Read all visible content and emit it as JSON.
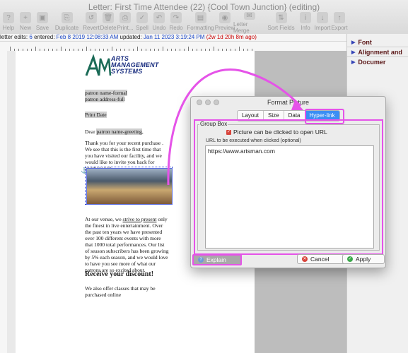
{
  "window": {
    "title": "Letter: First Time Attendee (22) {Cool Town Junction} (editing)"
  },
  "toolbar": [
    {
      "label": "Help",
      "icon": "help-icon",
      "glyph": "?"
    },
    {
      "label": "New",
      "icon": "new-icon",
      "glyph": "+"
    },
    {
      "label": "Save",
      "icon": "save-icon",
      "glyph": "▣"
    },
    {
      "label": "Duplicate",
      "icon": "duplicate-icon",
      "glyph": "⎘"
    },
    {
      "label": "Revert",
      "icon": "revert-icon",
      "glyph": "↺"
    },
    {
      "label": "Delete",
      "icon": "delete-icon",
      "glyph": "🗑"
    },
    {
      "label": "Print...",
      "icon": "print-icon",
      "glyph": "⎙"
    },
    {
      "label": "Spell",
      "icon": "spell-icon",
      "glyph": "✓"
    },
    {
      "label": "Undo",
      "icon": "undo-icon",
      "glyph": "↶"
    },
    {
      "label": "Redo",
      "icon": "redo-icon",
      "glyph": "↷"
    },
    {
      "label": "Formatting",
      "icon": "formatting-icon",
      "glyph": "▤"
    },
    {
      "label": "Preview",
      "icon": "preview-icon",
      "glyph": "◉"
    },
    {
      "label": "Letter Merge",
      "icon": "letter-merge-icon",
      "glyph": "✉"
    },
    {
      "label": "Sort Fields",
      "icon": "sort-fields-icon",
      "glyph": "⇅"
    },
    {
      "label": "Info",
      "icon": "info-icon",
      "glyph": "i"
    },
    {
      "label": "Import",
      "icon": "import-icon",
      "glyph": "↓"
    },
    {
      "label": "Export",
      "icon": "export-icon",
      "glyph": "↑"
    }
  ],
  "editsbar": {
    "edits_label": "letter edits:",
    "edits_count": "6",
    "entered_label": "entered:",
    "entered_value": "Feb 8 2019 12:08:33 AM",
    "updated_label": "updated:",
    "updated_value": "Jan 11 2023 3:19:24 PM",
    "elapsed": "(2w 1d 20h 8m ago)"
  },
  "right_panel": {
    "items": [
      "Font",
      "Alignment and",
      "Documer"
    ]
  },
  "document": {
    "logo_lines": [
      "ARTS",
      "MANAGEMENT",
      "SYSTEMS"
    ],
    "name_formal": "patron name-formal",
    "address_full": "patron address-full",
    "print_date": "Print Date",
    "greeting_prefix": "Dear ",
    "greeting_field": "patron name-greeting",
    "greeting_suffix": ",",
    "paragraph1": "Thank you for your recent purchase . We see that this is the first time that you have visited our facility, and we would like to invite you back for another visit.",
    "paragraph2_a": "At our venue, we ",
    "paragraph2_u": "strive to present",
    "paragraph2_b": " only the finest in live entertainment. Over the past ten years we have presented over 100 different events with more that 1000 total performances. Our list of season subscribers has been growing by 5% each season, and we would love to have you see more of what our patrons are so excited about.",
    "heading": "Receive your discount!",
    "paragraph3": "We also offer classes that may be purchased online"
  },
  "dialog": {
    "title": "Format Picture",
    "tabs": [
      "Layout",
      "Size",
      "Data",
      "Hyper-link"
    ],
    "active_tab": "Hyper-link",
    "group_box_title": "Group Box",
    "checkbox_label": "Picture can be clicked to open URL",
    "checkbox_checked": true,
    "url_label": "URL to be executed when clicked (optional)",
    "url_value": "https://www.artsman.com",
    "explain_label": "Explain",
    "cancel_label": "Cancel",
    "apply_label": "Apply"
  },
  "colors": {
    "highlight": "#e553e8",
    "accent": "#3b8ef4",
    "logo": "#1b2f80"
  }
}
